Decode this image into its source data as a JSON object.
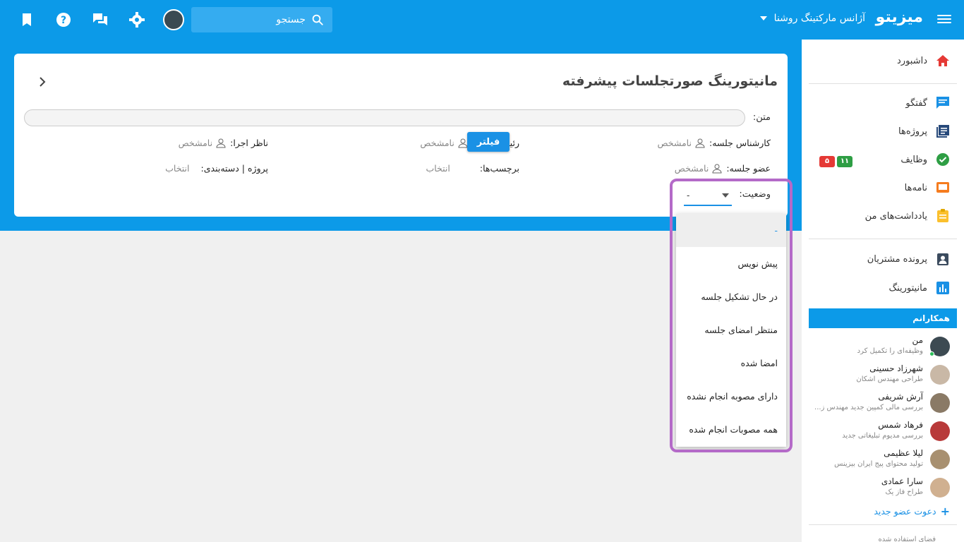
{
  "topbar": {
    "logo": "میزیتو",
    "org_name": "آژانس مارکتینگ روشنا",
    "search_placeholder": "جستجو"
  },
  "card": {
    "title": "مانیتورینگ صورتجلسات پیشرفته",
    "text_label": "متن:",
    "fields": {
      "expert_label": "کارشناس جلسه:",
      "expert_value": "نامشخص",
      "chair_label": "رئیس جلسه:",
      "chair_value": "نامشخص",
      "supervisor_label": "ناظر اجرا:",
      "supervisor_value": "نامشخص",
      "member_label": "عضو جلسه:",
      "member_value": "نامشخص",
      "tags_label": "برچسب‌ها:",
      "tags_value": "انتخاب",
      "project_label": "پروژه | دسته‌بندی:",
      "project_value": "انتخاب",
      "status_label": "وضعیت:",
      "status_value": "-"
    },
    "filter_button": "فیلتر"
  },
  "status_options": [
    "-",
    "پیش نویس",
    "در حال تشکیل جلسه",
    "منتظر امضای جلسه",
    "امضا شده",
    "دارای مصوبه انجام نشده",
    "همه مصوبات انجام شده"
  ],
  "sidebar": {
    "items": [
      {
        "label": "داشبورد",
        "icon": "home-icon",
        "color": "#e53935"
      },
      {
        "label": "گفتگو",
        "icon": "chat-icon",
        "color": "#1a91e5"
      },
      {
        "label": "پروژه‌ها",
        "icon": "projects-icon",
        "color": "#27497a"
      },
      {
        "label": "وظایف",
        "icon": "tasks-icon",
        "color": "#2e9e44"
      },
      {
        "label": "نامه‌ها",
        "icon": "letters-icon",
        "color": "#f57c1f"
      },
      {
        "label": "یادداشت‌های من",
        "icon": "notes-icon",
        "color": "#fbc02d"
      },
      {
        "label": "پرونده مشتریان",
        "icon": "customers-icon",
        "color": "#3b4b5e"
      },
      {
        "label": "مانیتورینگ",
        "icon": "monitoring-icon",
        "color": "#1a91e5"
      }
    ],
    "tasks_badge_green": "۱۱",
    "tasks_badge_red": "۵",
    "colleagues_title": "همکارانم",
    "colleagues": [
      {
        "name": "من",
        "sub": "وظیفه‌ای را تکمیل کرد"
      },
      {
        "name": "شهرزاد حسینی",
        "sub": "طراحی مهندس اشکان"
      },
      {
        "name": "آرش شریفی",
        "sub": "بررسی مالی کمپین جدید مهندس ز..."
      },
      {
        "name": "فرهاد شمس",
        "sub": "بررسی مدیوم تبلیغاتی جدید"
      },
      {
        "name": "لیلا عظیمی",
        "sub": "تولید محتوای پیج ایران بیزینس"
      },
      {
        "name": "سارا عمادی",
        "sub": "طراح فاز یک"
      }
    ],
    "invite": "دعوت عضو جدید",
    "usage": "فضای استفاده شده"
  }
}
